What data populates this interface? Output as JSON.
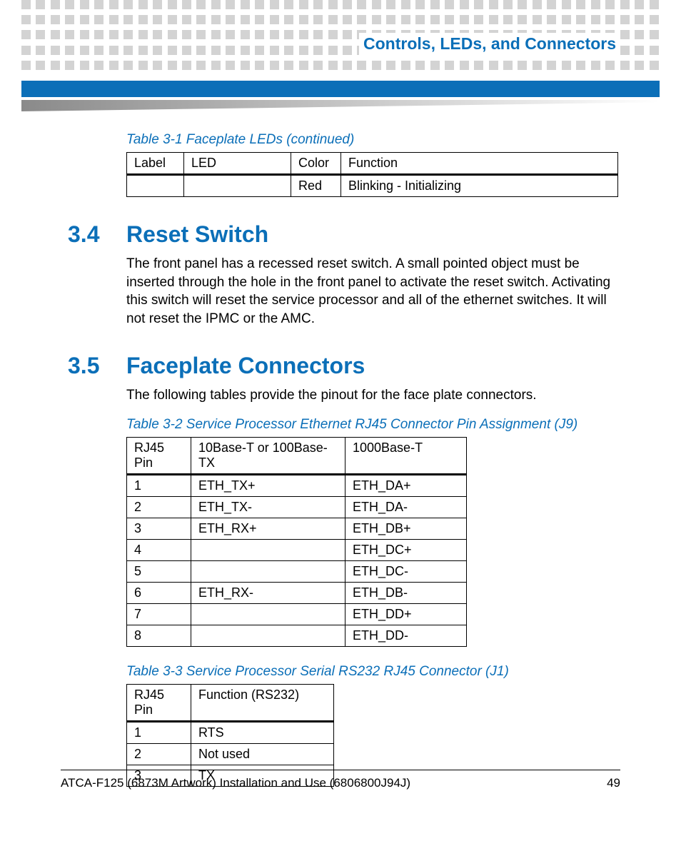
{
  "header": {
    "chapter_title": "Controls, LEDs, and Connectors"
  },
  "footer": {
    "doc_title": "ATCA-F125 (6873M Artwork) Installation and Use (6806800J94J)",
    "page_number": "49"
  },
  "table1": {
    "caption": "Table 3-1 Faceplate LEDs  (continued)",
    "headers": {
      "c1": "Label",
      "c2": "LED",
      "c3": "Color",
      "c4": "Function"
    },
    "rows": [
      {
        "c1": "",
        "c2": "",
        "c3": "Red",
        "c4": "Blinking - Initializing"
      }
    ]
  },
  "section34": {
    "num": "3.4",
    "title": "Reset Switch",
    "body": "The front panel has a recessed reset switch. A small pointed object must be inserted through the hole in the front panel to activate the reset switch. Activating this switch will reset the service processor and all of the ethernet switches. It will not reset the IPMC or the AMC."
  },
  "section35": {
    "num": "3.5",
    "title": "Faceplate Connectors",
    "body": "The following tables provide the pinout for the face plate connectors."
  },
  "table2": {
    "caption": "Table 3-2 Service Processor Ethernet RJ45 Connector Pin Assignment (J9)",
    "headers": {
      "c1": "RJ45 Pin",
      "c2": "10Base-T or 100Base-TX",
      "c3": "1000Base-T"
    },
    "rows": [
      {
        "c1": "1",
        "c2": "ETH_TX+",
        "c3": "ETH_DA+"
      },
      {
        "c1": "2",
        "c2": "ETH_TX-",
        "c3": "ETH_DA-"
      },
      {
        "c1": "3",
        "c2": "ETH_RX+",
        "c3": "ETH_DB+"
      },
      {
        "c1": "4",
        "c2": "",
        "c3": "ETH_DC+"
      },
      {
        "c1": "5",
        "c2": "",
        "c3": "ETH_DC-"
      },
      {
        "c1": "6",
        "c2": "ETH_RX-",
        "c3": "ETH_DB-"
      },
      {
        "c1": "7",
        "c2": "",
        "c3": "ETH_DD+"
      },
      {
        "c1": "8",
        "c2": "",
        "c3": "ETH_DD-"
      }
    ]
  },
  "table3": {
    "caption": "Table 3-3 Service Processor Serial RS232 RJ45 Connector (J1)",
    "headers": {
      "c1": "RJ45 Pin",
      "c2": "Function (RS232)"
    },
    "rows": [
      {
        "c1": "1",
        "c2": "RTS"
      },
      {
        "c1": "2",
        "c2": "Not used"
      },
      {
        "c1": "3",
        "c2": "TX"
      }
    ]
  }
}
